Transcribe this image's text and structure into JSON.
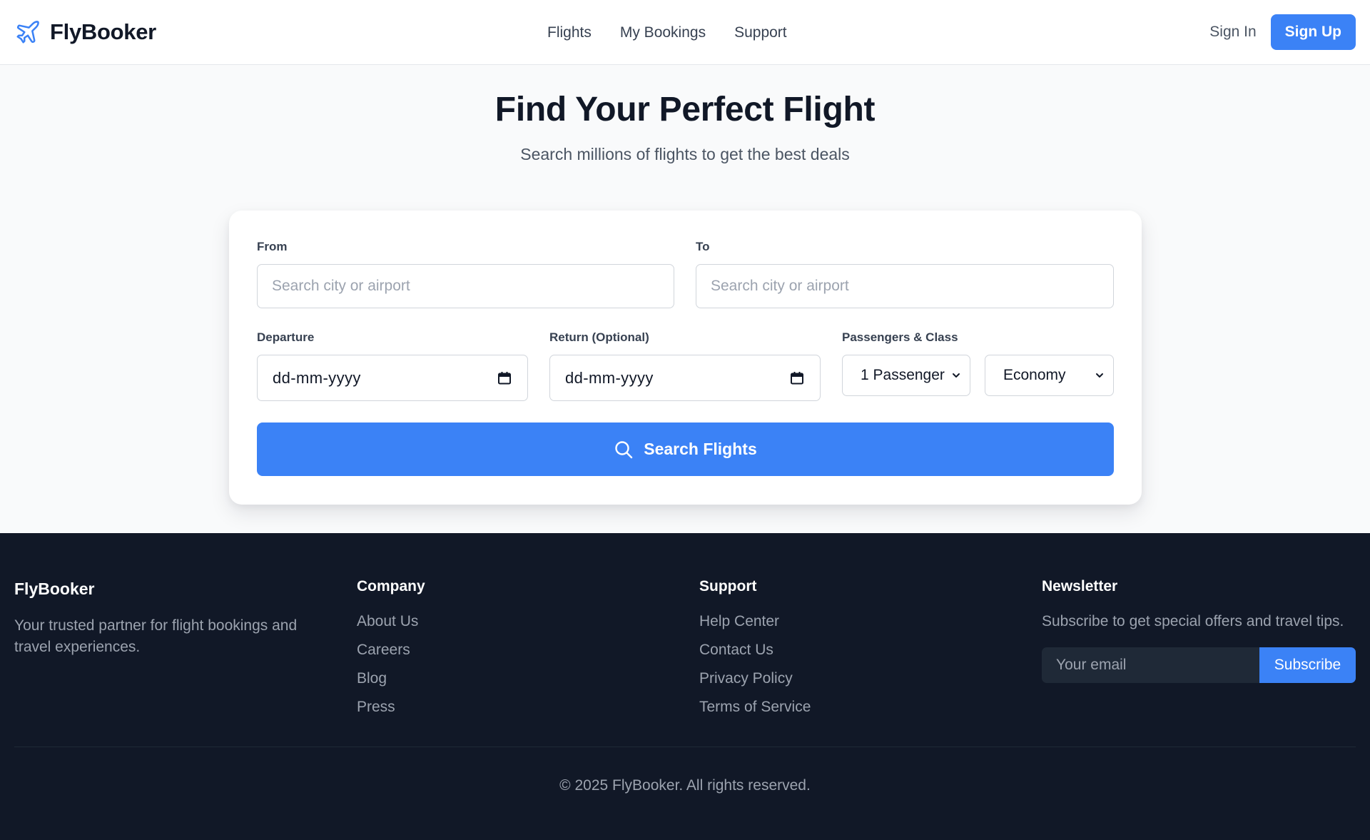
{
  "brand": {
    "name": "FlyBooker",
    "icon": "airplane-icon",
    "accent": "#3b82f6"
  },
  "nav": {
    "items": [
      {
        "label": "Flights"
      },
      {
        "label": "My Bookings"
      },
      {
        "label": "Support"
      }
    ]
  },
  "auth": {
    "sign_in": "Sign In",
    "sign_up": "Sign Up"
  },
  "hero": {
    "title": "Find Your Perfect Flight",
    "subtitle": "Search millions of flights to get the best deals"
  },
  "search": {
    "from_label": "From",
    "from_placeholder": "Search city or airport",
    "to_label": "To",
    "to_placeholder": "Search city or airport",
    "departure_label": "Departure",
    "departure_value": "dd-mm-yyyy",
    "return_label": "Return (Optional)",
    "return_value": "dd-mm-yyyy",
    "passengers_label": "Passengers & Class",
    "passengers_value": "1 Passenger",
    "class_value": "Economy",
    "button_label": "Search Flights",
    "button_icon": "search-icon"
  },
  "footer": {
    "brand": "FlyBooker",
    "about": "Your trusted partner for flight bookings and travel experiences.",
    "company": {
      "heading": "Company",
      "links": [
        "About Us",
        "Careers",
        "Blog",
        "Press"
      ]
    },
    "support": {
      "heading": "Support",
      "links": [
        "Help Center",
        "Contact Us",
        "Privacy Policy",
        "Terms of Service"
      ]
    },
    "newsletter": {
      "heading": "Newsletter",
      "text": "Subscribe to get special offers and travel tips.",
      "email_placeholder": "Your email",
      "button": "Subscribe"
    },
    "copyright": "© 2025 FlyBooker. All rights reserved."
  },
  "colors": {
    "primary": "#3b82f6",
    "footer_bg": "#111827",
    "page_bg": "#f9fafb"
  }
}
